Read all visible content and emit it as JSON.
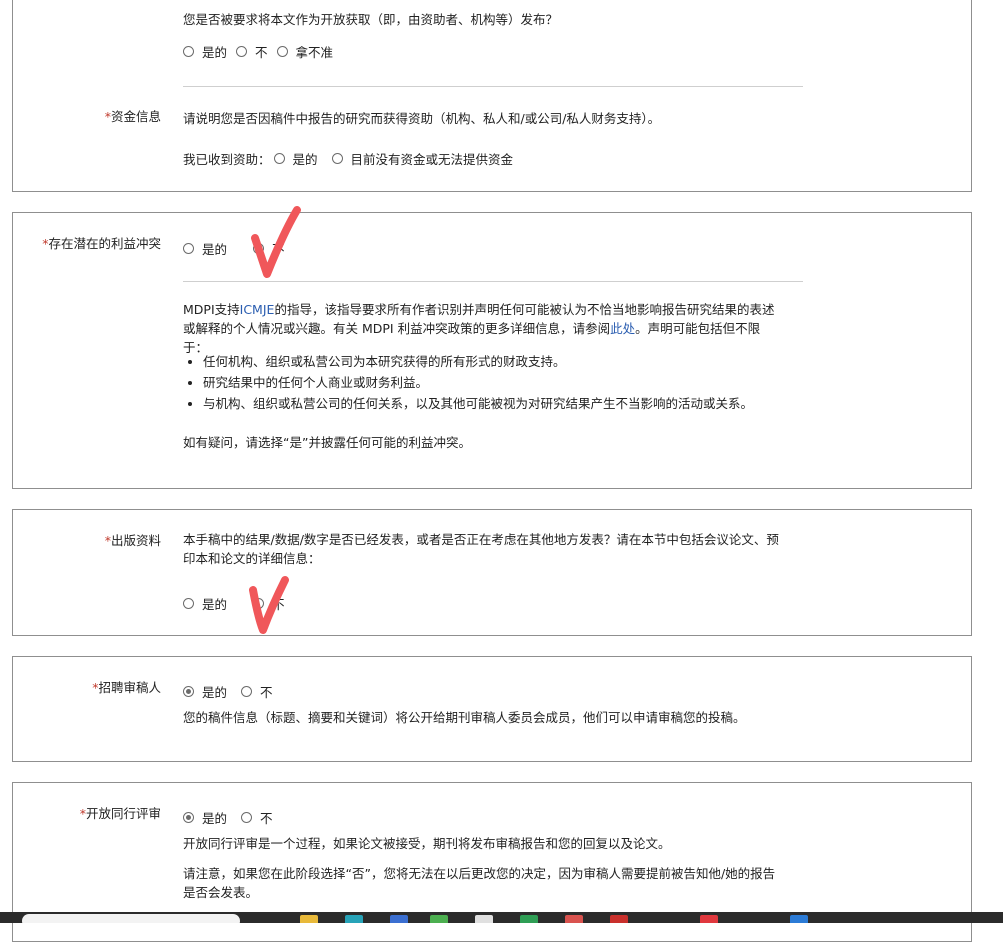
{
  "open_access": {
    "question": "您是否被要求将本文作为开放获取（即，由资助者、机构等）发布？",
    "options": [
      "是的",
      "不",
      "拿不准"
    ]
  },
  "funding": {
    "label": "资金信息",
    "description": "请说明您是否因稿件中报告的研究而获得资助（机构、私人和/或公司/私人财务支持）。",
    "received_label": "我已收到资助：",
    "options": [
      "是的",
      "目前没有资金或无法提供资金"
    ]
  },
  "conflict": {
    "label": "存在潜在的利益冲突",
    "options": [
      "是的",
      "不"
    ],
    "para_1_a": "MDPI支持",
    "para_1_link": "ICMJE",
    "para_1_b": "的指导，该指导要求所有作者识别并声明任何可能被认为不恰当地影响报告研究结果的表述",
    "para_2_a": "或解释的个人情况或兴趣。有关 MDPI 利益冲突政策的更多详细信息，请参阅",
    "para_2_link": "此处",
    "para_2_b": "。声明可能包括但不限",
    "para_3": "于：",
    "bullets": [
      "任何机构、组织或私营公司为本研究获得的所有形式的财政支持。",
      "研究结果中的任何个人商业或财务利益。",
      "与机构、组织或私营公司的任何关系，以及其他可能被视为对研究结果产生不当影响的活动或关系。"
    ],
    "note": "如有疑问，请选择“是”并披露任何可能的利益冲突。"
  },
  "publication": {
    "label": "出版资料",
    "desc_line1": "本手稿中的结果/数据/数字是否已经发表，或者是否正在考虑在其他地方发表？请在本节中包括会议论文、预",
    "desc_line2": "印本和论文的详细信息：",
    "options": [
      "是的",
      "不"
    ]
  },
  "reviewer": {
    "label": "招聘审稿人",
    "options": [
      "是的",
      "不"
    ],
    "selected": "是的",
    "desc": "您的稿件信息（标题、摘要和关键词）将公开给期刊审稿人委员会成员，他们可以申请审稿您的投稿。"
  },
  "open_review": {
    "label": "开放同行评审",
    "options": [
      "是的",
      "不"
    ],
    "selected": "是的",
    "desc": "开放同行评审是一个过程，如果论文被接受，期刊将发布审稿报告和您的回复以及论文。",
    "note_line1": "请注意，如果您在此阶段选择“否”，您将无法在以后更改您的决定，因为审稿人需要提前被告知他/她的报告",
    "note_line2": "是否会发表。"
  },
  "required_mark": "*",
  "colors": {
    "required": "#c0392b",
    "link": "#2a5db0",
    "checkmark": "#f0575a",
    "border": "#8f8f8f"
  }
}
